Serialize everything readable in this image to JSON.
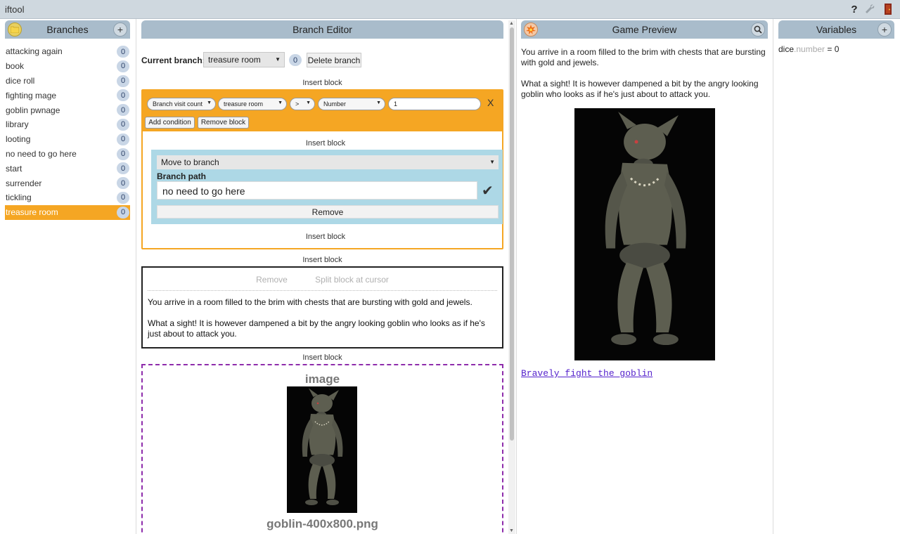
{
  "app": {
    "title": "iftool"
  },
  "topbar_icons": [
    "help-icon",
    "wrench-icon",
    "door-exit-icon"
  ],
  "branches": {
    "header": "Branches",
    "add_label": "+",
    "items": [
      {
        "name": "attacking again",
        "count": "0"
      },
      {
        "name": "book",
        "count": "0"
      },
      {
        "name": "dice roll",
        "count": "0"
      },
      {
        "name": "fighting mage",
        "count": "0"
      },
      {
        "name": "goblin pwnage",
        "count": "0"
      },
      {
        "name": "library",
        "count": "0"
      },
      {
        "name": "looting",
        "count": "0"
      },
      {
        "name": "no need to go here",
        "count": "0"
      },
      {
        "name": "start",
        "count": "0"
      },
      {
        "name": "surrender",
        "count": "0"
      },
      {
        "name": "tickling",
        "count": "0"
      },
      {
        "name": "treasure room",
        "count": "0",
        "selected": true
      }
    ]
  },
  "editor": {
    "header": "Branch Editor",
    "current_branch_label": "Current branch:",
    "current_branch_value": "treasure room",
    "current_branch_count": "0",
    "delete_label": "Delete branch",
    "insert_label": "Insert block",
    "condition": {
      "type": "Branch visit count",
      "branch": "treasure room",
      "operator": ">",
      "value_type": "Number",
      "value": "1",
      "close_label": "X",
      "add_condition_label": "Add condition",
      "remove_block_label": "Remove block"
    },
    "action": {
      "type": "Move to branch",
      "path_label": "Branch path",
      "path_value": "no need to go here",
      "check": "✔",
      "remove_label": "Remove"
    },
    "text_block": {
      "remove_label": "Remove",
      "split_label": "Split block at cursor",
      "para1": "You arrive in a room filled to the brim with chests that are bursting with gold and jewels.",
      "para2": "What a sight! It is however dampened a bit by the angry looking goblin who looks as if he's just about to attack you."
    },
    "image_block": {
      "title": "image",
      "filename": "goblin-400x800.png"
    }
  },
  "preview": {
    "header": "Game Preview",
    "para1": "You arrive in a room filled to the brim with chests that are bursting with gold and jewels.",
    "para2": "What a sight! It is however dampened a bit by the angry looking goblin who looks as if he's just about to attack you.",
    "choice": "Bravely fight the goblin"
  },
  "variables": {
    "header": "Variables",
    "add_label": "+",
    "items": [
      {
        "name": "dice",
        "type": ".number",
        "value": " = 0"
      }
    ]
  },
  "colors": {
    "accent": "#f5a623",
    "header": "#a9bccb",
    "action": "#add8e6",
    "image_border": "#8e2cab",
    "link": "#5522cc"
  }
}
